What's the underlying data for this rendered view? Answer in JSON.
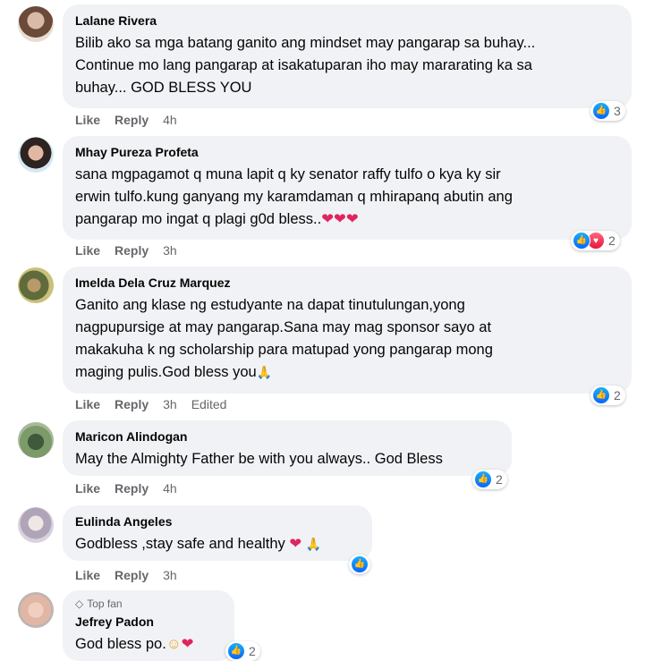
{
  "comments": [
    {
      "author": "Lalane Rivera",
      "text": "Bilib ako sa mga batang ganito ang mindset may pangarap sa buhay...\nContinue mo lang pangarap at isakatuparan iho may mararating ka sa\nbuhay... GOD BLESS YOU",
      "like": "Like",
      "reply": "Reply",
      "time": "4h",
      "reaction_count": "3"
    },
    {
      "author": "Mhay Pureza Profeta",
      "text": "sana mgpagamot q muna lapit q ky senator raffy tulfo o kya ky sir\nerwin tulfo.kung ganyang my karamdaman q mhirapanq abutin ang\npangarap mo ingat q plagi g0d bless..",
      "hearts": "❤❤❤",
      "like": "Like",
      "reply": "Reply",
      "time": "3h",
      "reaction_count": "2"
    },
    {
      "author": "Imelda Dela Cruz Marquez",
      "text": "Ganito ang klase ng estudyante na dapat tinutulungan,yong\nnagpupursige at may pangarap.Sana may mag sponsor sayo at\nmakakuha k ng scholarship para matupad yong pangarap mong\nmaging pulis.God bless you",
      "emoji": "🙏",
      "like": "Like",
      "reply": "Reply",
      "time": "3h",
      "edited": "Edited",
      "reaction_count": "2"
    },
    {
      "author": "Maricon Alindogan",
      "text": "May the Almighty Father be with you always.. God Bless",
      "like": "Like",
      "reply": "Reply",
      "time": "4h",
      "reaction_count": "2"
    },
    {
      "author": "Eulinda Angeles",
      "text": "Godbless ,stay safe and healthy ",
      "hearts": "❤",
      "emoji": "🙏",
      "like": "Like",
      "reply": "Reply",
      "time": "3h"
    },
    {
      "badge": "Top fan",
      "author": "Jefrey Padon",
      "text": "God bless po.",
      "emoji": "☺",
      "hearts": "❤",
      "reaction_count": "2"
    }
  ],
  "icons": {
    "like": "thumbs-up-icon",
    "love": "heart-icon",
    "topfan": "diamond-icon"
  },
  "colors": {
    "like_blue": "#0866ff",
    "heart_red": "#e61739",
    "bubble_bg": "#f0f2f5",
    "meta_gray": "#65676b"
  }
}
